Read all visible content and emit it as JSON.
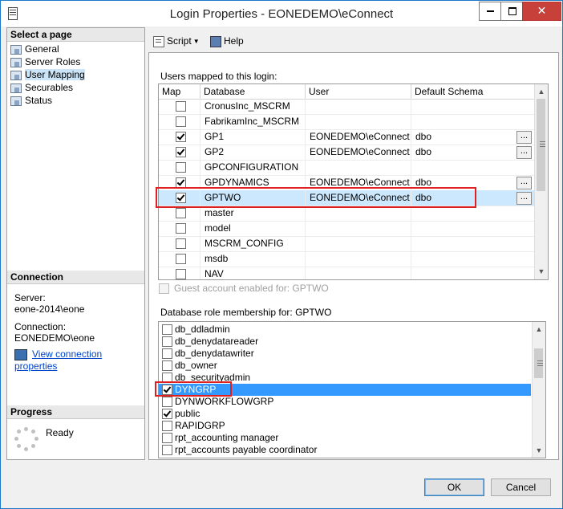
{
  "window": {
    "title": "Login Properties - EONEDEMO\\eConnect"
  },
  "sidebar": {
    "select_page_header": "Select a page",
    "items": [
      {
        "label": "General"
      },
      {
        "label": "Server Roles"
      },
      {
        "label": "User Mapping",
        "selected": true
      },
      {
        "label": "Securables"
      },
      {
        "label": "Status"
      }
    ],
    "connection_header": "Connection",
    "server_label": "Server:",
    "server_value": "eone-2014\\eone",
    "connection_label": "Connection:",
    "connection_value": "EONEDEMO\\eone",
    "view_connection_link": "View connection properties",
    "progress_header": "Progress",
    "progress_status": "Ready"
  },
  "toolbar": {
    "script_label": "Script",
    "help_label": "Help"
  },
  "mapping": {
    "title": "Users mapped to this login:",
    "columns": [
      "Map",
      "Database",
      "User",
      "Default Schema"
    ],
    "rows": [
      {
        "map": false,
        "database": "CronusInc_MSCRM",
        "user": "",
        "schema": "",
        "ellipsis": false
      },
      {
        "map": false,
        "database": "FabrikamInc_MSCRM",
        "user": "",
        "schema": "",
        "ellipsis": false
      },
      {
        "map": true,
        "database": "GP1",
        "user": "EONEDEMO\\eConnect",
        "schema": "dbo",
        "ellipsis": true
      },
      {
        "map": true,
        "database": "GP2",
        "user": "EONEDEMO\\eConnect",
        "schema": "dbo",
        "ellipsis": true
      },
      {
        "map": false,
        "database": "GPCONFIGURATION",
        "user": "",
        "schema": "",
        "ellipsis": false
      },
      {
        "map": true,
        "database": "GPDYNAMICS",
        "user": "EONEDEMO\\eConnect",
        "schema": "dbo",
        "ellipsis": true
      },
      {
        "map": true,
        "database": "GPTWO",
        "user": "EONEDEMO\\eConnect",
        "schema": "dbo",
        "ellipsis": true,
        "selected": true
      },
      {
        "map": false,
        "database": "master",
        "user": "",
        "schema": "",
        "ellipsis": false
      },
      {
        "map": false,
        "database": "model",
        "user": "",
        "schema": "",
        "ellipsis": false
      },
      {
        "map": false,
        "database": "MSCRM_CONFIG",
        "user": "",
        "schema": "",
        "ellipsis": false
      },
      {
        "map": false,
        "database": "msdb",
        "user": "",
        "schema": "",
        "ellipsis": false
      },
      {
        "map": false,
        "database": "NAV",
        "user": "",
        "schema": "",
        "ellipsis": false
      }
    ],
    "guest_label": "Guest account enabled for: GPTWO"
  },
  "roles": {
    "title": "Database role membership for: GPTWO",
    "items": [
      {
        "label": "db_ddladmin",
        "checked": false
      },
      {
        "label": "db_denydatareader",
        "checked": false
      },
      {
        "label": "db_denydatawriter",
        "checked": false
      },
      {
        "label": "db_owner",
        "checked": false
      },
      {
        "label": "db_securityadmin",
        "checked": false
      },
      {
        "label": "DYNGRP",
        "checked": true,
        "selected": true
      },
      {
        "label": "DYNWORKFLOWGRP",
        "checked": false
      },
      {
        "label": "public",
        "checked": true
      },
      {
        "label": "RAPIDGRP",
        "checked": false
      },
      {
        "label": "rpt_accounting manager",
        "checked": false
      },
      {
        "label": "rpt_accounts payable coordinator",
        "checked": false
      }
    ]
  },
  "buttons": {
    "ok": "OK",
    "cancel": "Cancel"
  }
}
